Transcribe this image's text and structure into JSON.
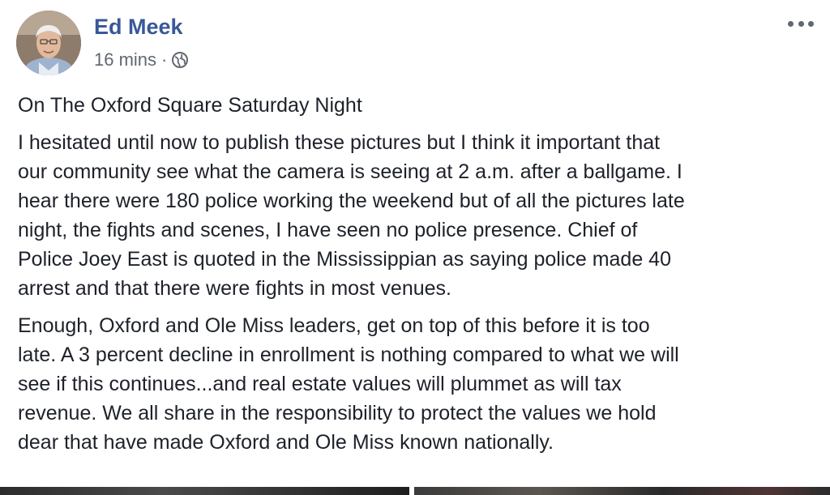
{
  "post": {
    "author": "Ed Meek",
    "timestamp": "16 mins",
    "separator": "·",
    "privacy_icon": "globe-icon",
    "more_icon": "more-options-icon",
    "paragraphs": [
      "On The Oxford Square Saturday Night",
      "I hesitated until now to publish these pictures but I think it important that\nour community see what the camera is seeing at 2 a.m. after a ballgame. I\nhear there were 180 police working the weekend but of all the pictures late\nnight, the fights and scenes, I have seen no police presence. Chief of\nPolice Joey East is quoted in the Mississippian as saying police made 40\narrest and that there were fights in most venues.",
      "Enough, Oxford and Ole Miss leaders, get on top of this before it is too\nlate. A 3 percent decline in enrollment is nothing compared to what we will\nsee if this continues...and real estate values will plummet as will tax\nrevenue. We all share in the responsibility to protect the values we hold\ndear that have made Oxford and Ole Miss known nationally."
    ]
  },
  "colors": {
    "author_link": "#385898",
    "meta_text": "#616770",
    "body_text": "#1d2129"
  }
}
